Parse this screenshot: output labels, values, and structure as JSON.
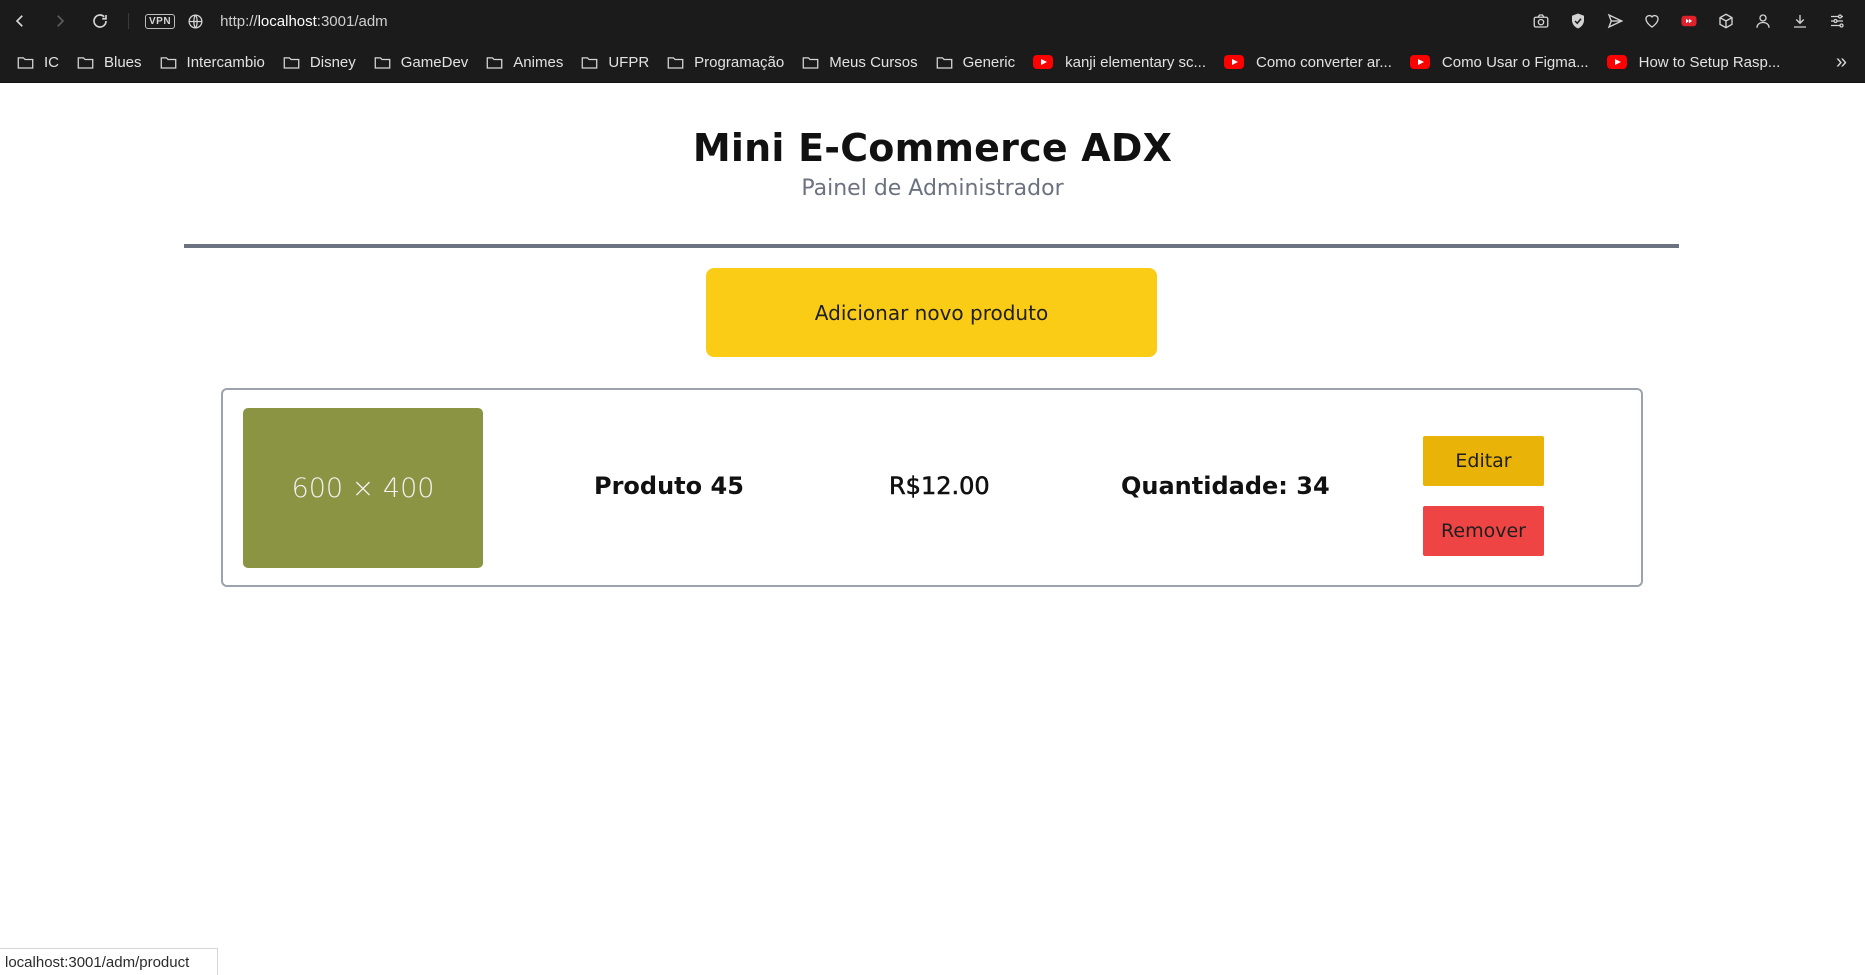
{
  "browser": {
    "vpn_label": "VPN",
    "url_prefix": "http://",
    "url_host": "localhost",
    "url_rest": ":3001/adm",
    "bookmarks": [
      {
        "label": "IC",
        "icon": "folder-icon"
      },
      {
        "label": "Blues",
        "icon": "folder-icon"
      },
      {
        "label": "Intercambio",
        "icon": "folder-icon"
      },
      {
        "label": "Disney",
        "icon": "folder-icon"
      },
      {
        "label": "GameDev",
        "icon": "folder-icon"
      },
      {
        "label": "Animes",
        "icon": "folder-icon"
      },
      {
        "label": "UFPR",
        "icon": "folder-icon"
      },
      {
        "label": "Programação",
        "icon": "folder-icon"
      },
      {
        "label": "Meus Cursos",
        "icon": "folder-icon"
      },
      {
        "label": "Generic",
        "icon": "folder-icon"
      },
      {
        "label": "kanji elementary sc...",
        "icon": "youtube-icon"
      },
      {
        "label": "Como converter ar...",
        "icon": "youtube-icon"
      },
      {
        "label": "Como Usar o Figma...",
        "icon": "youtube-icon"
      },
      {
        "label": "How to Setup Rasp...",
        "icon": "youtube-icon"
      }
    ],
    "more_label": "»",
    "status_url": "localhost:3001/adm/product"
  },
  "page": {
    "title": "Mini E-Commerce ADX",
    "subtitle": "Painel de Administrador",
    "add_button": "Adicionar novo produto"
  },
  "products": [
    {
      "image_placeholder": "600 × 400",
      "name": "Produto 45",
      "price": "R$12.00",
      "quantity": "Quantidade: 34",
      "edit_label": "Editar",
      "remove_label": "Remover"
    }
  ],
  "colors": {
    "add_button": "#facc15",
    "edit_button": "#eab308",
    "remove_button": "#ef4444",
    "thumb": "#8a9442"
  }
}
